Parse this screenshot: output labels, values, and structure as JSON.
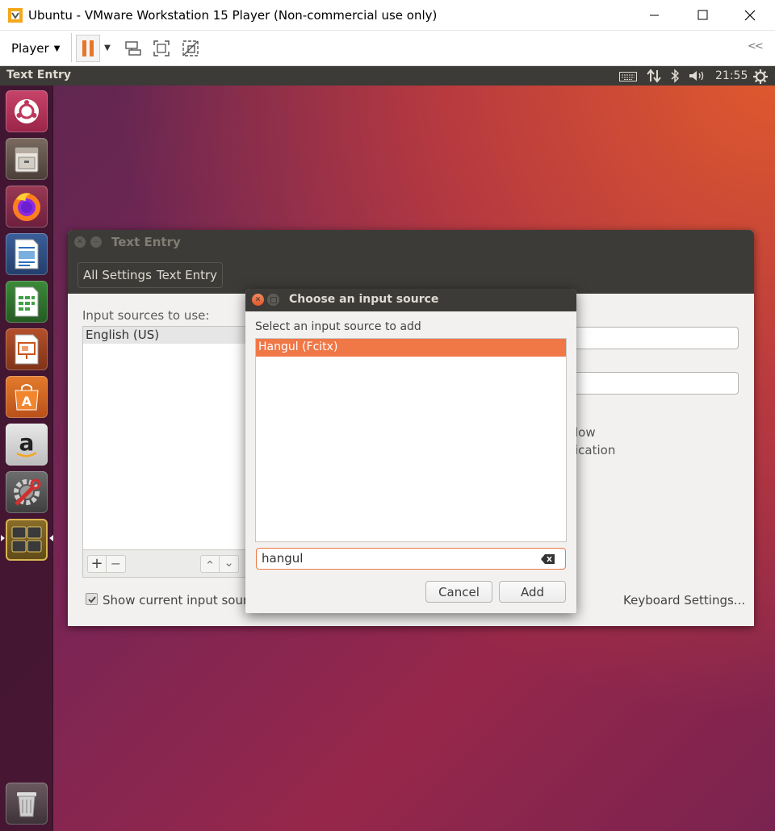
{
  "vmware": {
    "title": "Ubuntu - VMware Workstation 15 Player (Non-commercial use only)",
    "player_menu": "Player",
    "collapse_glyph": "<<"
  },
  "ubuntu_panel": {
    "app_title": "Text Entry",
    "clock": "21:55"
  },
  "launcher": {
    "items": [
      "ubuntu-dash",
      "files",
      "firefox",
      "libreoffice-writer",
      "libreoffice-calc",
      "libreoffice-impress",
      "ubuntu-software",
      "amazon",
      "system-settings",
      "workspace-switcher",
      "trash"
    ]
  },
  "text_entry": {
    "window_title": "Text Entry",
    "breadcrumbs": [
      "All Settings",
      "Text Entry"
    ],
    "input_sources_label": "Input sources to use:",
    "input_sources": [
      "English (US)"
    ],
    "add_glyph": "+",
    "remove_glyph": "−",
    "up_glyph": "⌃",
    "down_glyph": "⌄",
    "show_current_label": "Show current input source",
    "show_current_checked": true,
    "partial_text_1": "low",
    "partial_text_2": "ication",
    "keyboard_settings": "Keyboard Settings..."
  },
  "dialog": {
    "title": "Choose an input source",
    "prompt": "Select an input source to add",
    "results": [
      "Hangul (Fcitx)"
    ],
    "selected_index": 0,
    "search_value": "hangul",
    "cancel_label": "Cancel",
    "add_label": "Add"
  },
  "colors": {
    "accent": "#f07746",
    "panel": "#3c3b37",
    "window_bg": "#f2f1f0"
  }
}
